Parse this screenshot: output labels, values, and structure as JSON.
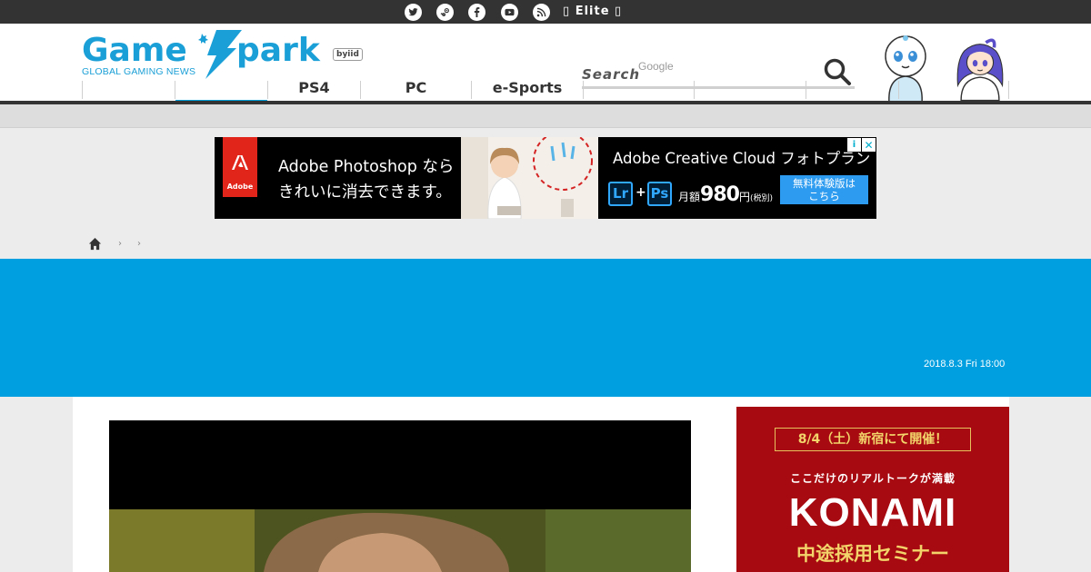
{
  "topbar": {
    "left_text": "",
    "social_icons": [
      "twitter-icon",
      "steam-icon",
      "facebook-icon",
      "youtube-icon",
      "rss-icon"
    ],
    "elite_label": "Elite"
  },
  "header": {
    "logo_text": "GameSpark",
    "logo_subtitle": "GLOBAL GAMING NEWS",
    "logo_badge": "byiid",
    "search_label": "Search",
    "search_provider": "Google",
    "brand_color": "#009fd9"
  },
  "nav": {
    "items": [
      {
        "label": ""
      },
      {
        "label": ""
      },
      {
        "label": "PS4"
      },
      {
        "label": "PC"
      },
      {
        "label": "e-Sports"
      },
      {
        "label": ""
      },
      {
        "label": ""
      },
      {
        "label": ""
      },
      {
        "label": ""
      }
    ]
  },
  "ad_banner": {
    "brand": "Adobe",
    "copy_line1": "Adobe Photoshop なら",
    "copy_line2": "きれいに消去できます。",
    "title": "Adobe Creative Cloud フォトプラン",
    "icon_lr": "Lr",
    "icon_ps": "Ps",
    "plus": "+",
    "price_prefix": "月額",
    "price_value": "980",
    "price_unit": "円",
    "price_note": "(税別)",
    "cta_line1": "無料体験版は",
    "cta_line2": "こちら",
    "choices_icon": "info-icon",
    "close_icon": "close-icon"
  },
  "breadcrumb": {
    "separators": [
      "›",
      "›"
    ]
  },
  "hero": {
    "date": "2018.8.3 Fri 18:00",
    "color": "#00a0e0"
  },
  "side_ad": {
    "date_line": "8/4（土）新宿にて開催！",
    "tagline": "ここだけのリアルトークが満載",
    "brand": "KONAMI",
    "subtitle": "中途採用セミナー",
    "bg_color": "#a70a10"
  }
}
